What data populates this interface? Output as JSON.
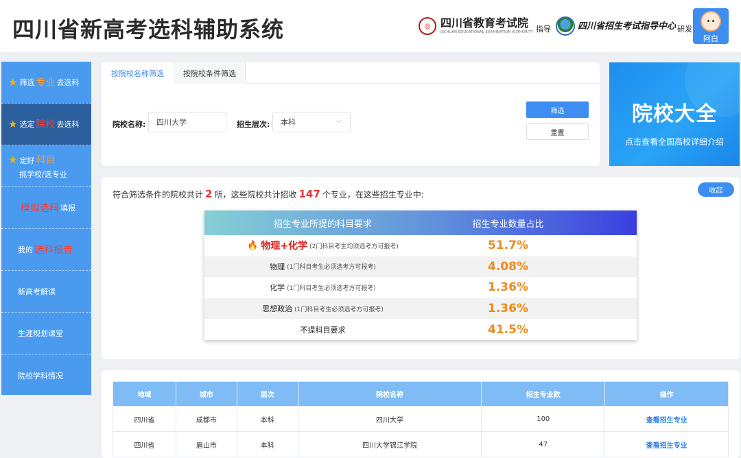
{
  "header": {
    "title": "四川省新高考选科辅助系统",
    "org1": {
      "name": "四川省教育考试院",
      "name_en": "SICHUAN EDUCATIONAL EXAMINATION AUTHORITY",
      "role": "指导"
    },
    "org2": {
      "name": "四川省招生考试指导中心",
      "role": "研发"
    },
    "user": {
      "name": "阿白"
    }
  },
  "sidebar": {
    "items": [
      {
        "pre": "筛选",
        "hl": "专业",
        "post": "去选科"
      },
      {
        "pre": "选定",
        "hl": "院校",
        "post": "去选科"
      },
      {
        "pre": "定好",
        "hl": "科目",
        "line2": "挑学校/选专业"
      },
      {
        "hl": "模拟选科",
        "post": "填报"
      },
      {
        "pre": "我的",
        "hl": "选科报告"
      },
      {
        "label": "新高考解读"
      },
      {
        "label": "生涯规划课堂"
      },
      {
        "label": "院校学科情况"
      }
    ]
  },
  "filter": {
    "tabs": [
      "按院校名称筛选",
      "按院校条件筛选"
    ],
    "school_label": "院校名称:",
    "school_value": "四川大学",
    "level_label": "招生层次:",
    "level_value": "本科",
    "filter_button": "筛选",
    "reset_button": "重置"
  },
  "banner": {
    "title": "院校大全",
    "subtitle": "点击查看全国高校详细介绍"
  },
  "result": {
    "summary_pre": "符合筛选条件的院校共计",
    "school_count": "2",
    "summary_mid": "所，这些院校共计招收",
    "major_count": "147",
    "summary_post": "个专业，在这些招生专业中:",
    "collapse_button": "收起",
    "table_head": [
      "招生专业所提的科目要求",
      "招生专业数量占比"
    ],
    "rows": [
      {
        "subject": "物理+化学",
        "note": "(2门科目考生均须选考方可报考)",
        "ratio": "51.7%",
        "top": true
      },
      {
        "subject": "物理",
        "note": "(1门科目考生必须选考方可报考)",
        "ratio": "4.08%"
      },
      {
        "subject": "化学",
        "note": "(1门科目考生必须选考方可报考)",
        "ratio": "1.36%"
      },
      {
        "subject": "思想政治",
        "note": "(1门科目考生必须选考方可报考)",
        "ratio": "1.36%"
      },
      {
        "subject": "不提科目要求",
        "note": "",
        "ratio": "41.5%"
      }
    ]
  },
  "list": {
    "columns": [
      "地域",
      "城市",
      "层次",
      "院校名称",
      "招生专业数",
      "操作"
    ],
    "rows": [
      [
        "四川省",
        "成都市",
        "本科",
        "四川大学",
        "100",
        "查看招生专业"
      ],
      [
        "四川省",
        "眉山市",
        "本科",
        "四川大学锦江学院",
        "47",
        "查看招生专业"
      ]
    ]
  },
  "colors": {
    "accent": "#3d8ef0",
    "sidebar": "#4a9bf0",
    "sidebar_active": "#2c5f9e",
    "ratio": "#f08a1c",
    "highlight": "#e63232"
  }
}
